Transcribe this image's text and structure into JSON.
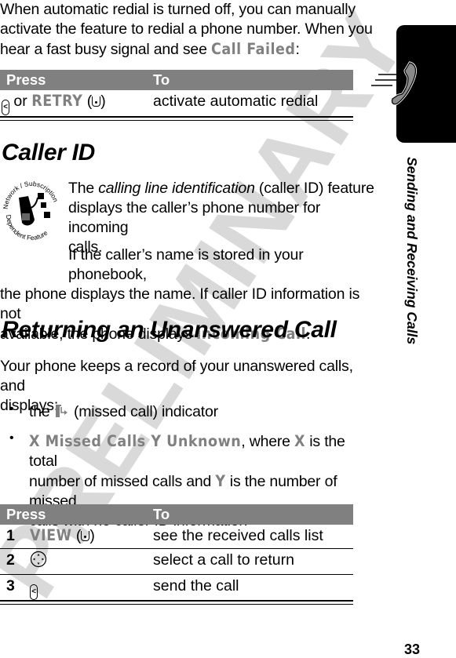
{
  "intro": {
    "line1": "When automatic redial is turned off, you can manually",
    "line2": "activate the feature to redial a phone number. When you",
    "line3_prefix": "hear a fast busy signal and see ",
    "line3_display": "Call Failed",
    "line3_suffix": ":"
  },
  "table1": {
    "header_press": "Press",
    "header_to": "To",
    "rows": [
      {
        "press_or": "or",
        "press_label": "RETRY",
        "to": "activate automatic redial"
      }
    ]
  },
  "caller_id": {
    "heading": "Caller ID",
    "badge_top": "Network / Subscription",
    "badge_bottom": "Dependent Feature",
    "p1_prefix": "The ",
    "p1_italic": "calling line identification",
    "p1_line1_suffix": " (caller ID) feature",
    "p1_line2": "displays the caller’s phone number for incoming",
    "p1_line3": "calls.",
    "p2_line1": "If the caller’s name is stored in your phonebook,",
    "p2_line2": "the phone displays the name. If caller ID information is not",
    "p2_line3_prefix": "available, the phone displays ",
    "p2_line3_display": "Incoming Call",
    "p2_line3_suffix": "."
  },
  "returning": {
    "heading": "Returning an Unanswered Call",
    "p_line1": "Your phone keeps a record of your unanswered calls, and",
    "p_line2": "displays:",
    "bullet1_prefix": "the ",
    "bullet1_suffix": " (missed call) indicator",
    "bullet2_display": "X Missed Calls Y Unknown",
    "bullet2_l1_mid": ", where ",
    "bullet2_x": "X",
    "bullet2_l1_end": " is the total",
    "bullet2_l2_prefix": "number of missed calls and ",
    "bullet2_y": "Y",
    "bullet2_l2_end": " is the number of missed",
    "bullet2_l3": "calls with no caller ID information"
  },
  "table2": {
    "header_press": "Press",
    "header_to": "To",
    "rows": [
      {
        "num": "1",
        "press_label": "VIEW",
        "to": "see the received calls list"
      },
      {
        "num": "2",
        "to": "select a call to return"
      },
      {
        "num": "3",
        "to": "send the call"
      }
    ]
  },
  "sidebar": {
    "section_title": "Sending and Receiving Calls"
  },
  "footer": {
    "page_number": "33"
  },
  "watermark": {
    "text": "PRELIMINARY",
    "color": "#d9d9d9"
  }
}
